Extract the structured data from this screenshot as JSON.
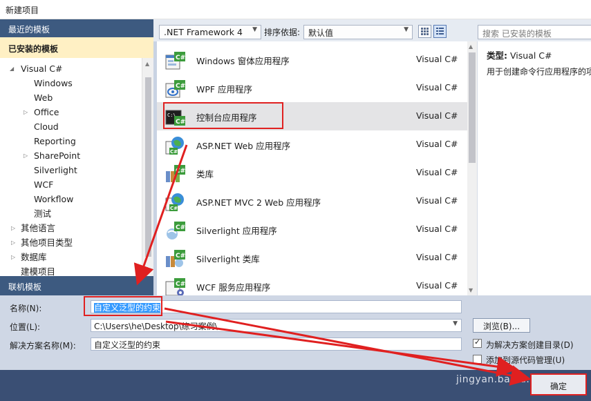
{
  "window": {
    "title": "新建项目"
  },
  "left_panel": {
    "recent_header": "最近的模板",
    "installed_header": "已安装的模板",
    "online_header": "联机模板",
    "tree": [
      {
        "label": "Visual C#",
        "expander": "◢"
      },
      {
        "label": "Windows",
        "expander": ""
      },
      {
        "label": "Web",
        "expander": ""
      },
      {
        "label": "Office",
        "expander": "▷"
      },
      {
        "label": "Cloud",
        "expander": ""
      },
      {
        "label": "Reporting",
        "expander": ""
      },
      {
        "label": "SharePoint",
        "expander": "▷"
      },
      {
        "label": "Silverlight",
        "expander": ""
      },
      {
        "label": "WCF",
        "expander": ""
      },
      {
        "label": "Workflow",
        "expander": ""
      },
      {
        "label": "测试",
        "expander": ""
      },
      {
        "label": "其他语言",
        "expander": "▷"
      },
      {
        "label": "其他项目类型",
        "expander": "▷"
      },
      {
        "label": "数据库",
        "expander": "▷"
      },
      {
        "label": "建模项目",
        "expander": ""
      }
    ]
  },
  "toolbar": {
    "framework": ".NET Framework 4",
    "sort_label": "排序依据:",
    "sort_value": "默认值",
    "search_placeholder": "搜索 已安装的模板"
  },
  "templates": [
    {
      "name": "Windows 窗体应用程序",
      "lang": "Visual C#",
      "icon": "windows-forms-icon"
    },
    {
      "name": "WPF 应用程序",
      "lang": "Visual C#",
      "icon": "wpf-icon"
    },
    {
      "name": "控制台应用程序",
      "lang": "Visual C#",
      "icon": "console-app-icon",
      "selected": true
    },
    {
      "name": "ASP.NET Web 应用程序",
      "lang": "Visual C#",
      "icon": "web-app-icon"
    },
    {
      "name": "类库",
      "lang": "Visual C#",
      "icon": "class-library-icon"
    },
    {
      "name": "ASP.NET MVC 2 Web 应用程序",
      "lang": "Visual C#",
      "icon": "mvc-web-icon"
    },
    {
      "name": "Silverlight 应用程序",
      "lang": "Visual C#",
      "icon": "silverlight-app-icon"
    },
    {
      "name": "Silverlight 类库",
      "lang": "Visual C#",
      "icon": "silverlight-library-icon"
    },
    {
      "name": "WCF 服务应用程序",
      "lang": "Visual C#",
      "icon": "wcf-service-icon"
    }
  ],
  "info": {
    "type_label": "类型:",
    "type_value": "Visual C#",
    "description": "用于创建命令行应用程序的项"
  },
  "form": {
    "name_label": "名称(N):",
    "name_value": "自定义泛型的约束",
    "location_label": "位置(L):",
    "location_value": "C:\\Users\\he\\Desktop\\练习案例\\",
    "solution_label": "解决方案名称(M):",
    "solution_value": "自定义泛型的约束",
    "browse_label": "浏览(B)...",
    "create_dir_label": "为解决方案创建目录(D)",
    "add_source_label": "添加到源代码管理(U)"
  },
  "footer": {
    "ok_label": "确定",
    "watermark": "jingyan.baidu.com"
  },
  "colors": {
    "accent_header": "#3d5a80",
    "installed_highlight": "#fff0c4",
    "annotation_red": "#e02020",
    "selection_blue": "#3399ff"
  }
}
